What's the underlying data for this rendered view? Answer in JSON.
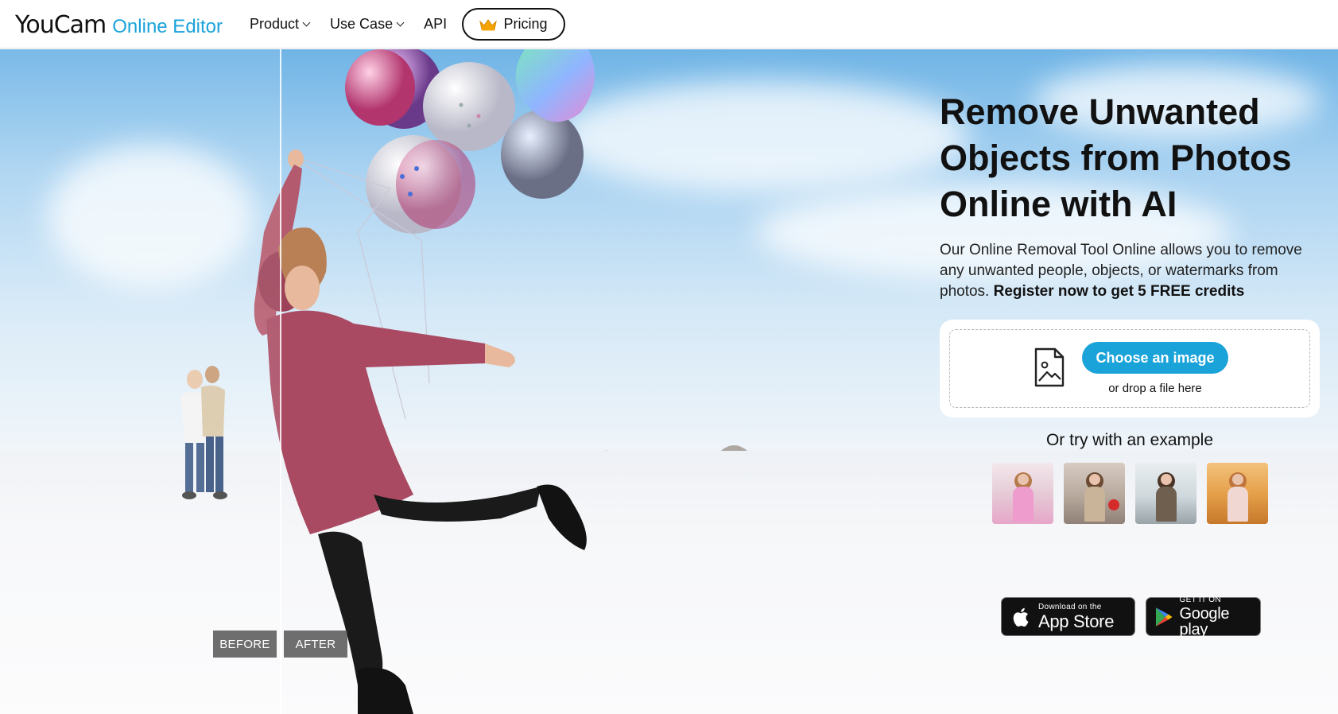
{
  "header": {
    "logo_main": "YouCam",
    "logo_sub": "Online Editor",
    "nav": [
      {
        "label": "Product",
        "has_dropdown": true
      },
      {
        "label": "Use Case",
        "has_dropdown": true
      },
      {
        "label": "API",
        "has_dropdown": false
      }
    ],
    "pricing_label": "Pricing",
    "pricing_icon": "crown-icon"
  },
  "hero": {
    "before_label": "BEFORE",
    "after_label": "AFTER"
  },
  "main": {
    "headline": "Remove Unwanted Objects from Photos Online with AI",
    "description": "Our Online Removal Tool Online allows you to remove any unwanted people, objects, or watermarks from photos.",
    "description_cta": "Register now to get 5 FREE credits",
    "upload": {
      "button_label": "Choose an image",
      "drop_text": "or drop a file here",
      "icon": "image-file-icon"
    },
    "try_title": "Or try with an example",
    "examples": [
      {
        "name": "example-pink-outfit-woman"
      },
      {
        "name": "example-street-stop-sign"
      },
      {
        "name": "example-winter-street"
      },
      {
        "name": "example-autumn-park"
      }
    ],
    "stores": {
      "apple_small": "Download on the",
      "apple_big": "App Store",
      "google_small": "GET IT ON",
      "google_big": "Google play"
    }
  },
  "colors": {
    "accent": "#1aa3d9",
    "text": "#111111",
    "tag_bg": "#464646"
  }
}
